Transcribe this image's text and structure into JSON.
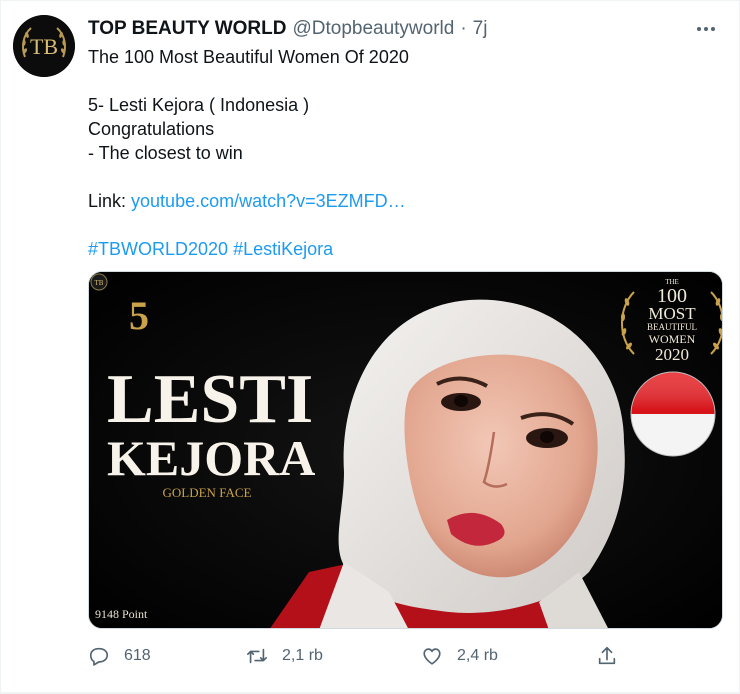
{
  "tweet": {
    "author_name": "TOP BEAUTY WORLD",
    "handle": "@Dtopbeautyworld",
    "separator": "·",
    "time": "7j",
    "avatar_text": "TB",
    "lines": {
      "l1": "The 100 Most Beautiful Women Of 2020",
      "l2": "5- Lesti Kejora ( Indonesia )",
      "l3": "Congratulations",
      "l4": "- The closest to win",
      "link_prefix": "Link: ",
      "link_text": "youtube.com/watch?v=3EZMFD…",
      "hashtag1": "#TBWORLD2020",
      "hashtag2": "#LestiKejora"
    }
  },
  "media": {
    "logo_text": "TB",
    "rank": "5",
    "first_name": "LESTI",
    "last_name": "KEJORA",
    "subtitle": "GOLDEN FACE",
    "points": "9148 Point",
    "badge": {
      "the": "THE",
      "line1": "100",
      "line2": "MOST",
      "line3": "BEAUTIFUL",
      "line4": "WOMEN",
      "year": "2020"
    },
    "flag_colors": {
      "top": "#d7141a",
      "bottom": "#ffffff"
    }
  },
  "actions": {
    "replies": "618",
    "retweets": "2,1 rb",
    "likes": "2,4 rb"
  },
  "colors": {
    "link": "#1d9bf0",
    "muted": "#536471",
    "gold": "#c9a24a"
  }
}
